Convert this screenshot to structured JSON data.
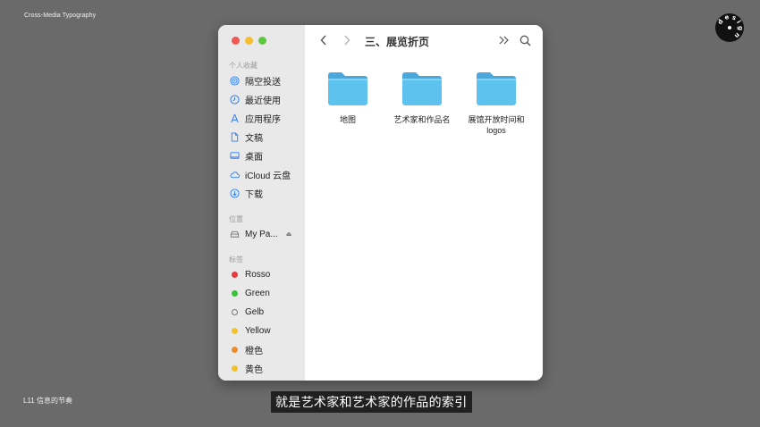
{
  "overlay": {
    "course_title": "Cross-Media Typography",
    "logo_text": "design",
    "lesson_label": "L11  信息的节奏",
    "subtitle": "就是艺术家和艺术家的作品的索引"
  },
  "window": {
    "title": "三、展览折页",
    "traffic_lights": {
      "close": "#ee5a52",
      "minimize": "#f5bd2f",
      "zoom": "#5fc63f"
    }
  },
  "sidebar": {
    "favorites_header": "个人收藏",
    "favorites": [
      {
        "label": "隔空投送",
        "icon": "airdrop-icon"
      },
      {
        "label": "最近使用",
        "icon": "clock-icon"
      },
      {
        "label": "应用程序",
        "icon": "applications-icon"
      },
      {
        "label": "文稿",
        "icon": "document-icon"
      },
      {
        "label": "桌面",
        "icon": "desktop-icon"
      },
      {
        "label": "iCloud 云盘",
        "icon": "cloud-icon"
      },
      {
        "label": "下载",
        "icon": "download-icon"
      }
    ],
    "locations_header": "位置",
    "locations": [
      {
        "label": "My Pa...",
        "icon": "drive-icon"
      }
    ],
    "tags_header": "标签",
    "tags": [
      {
        "label": "Rosso",
        "color": "#e8393c"
      },
      {
        "label": "Green",
        "color": "#37c337"
      },
      {
        "label": "Gelb",
        "color": "hollow"
      },
      {
        "label": "Yellow",
        "color": "#f1c12f"
      },
      {
        "label": "橙色",
        "color": "#f08c2a"
      },
      {
        "label": "黄色",
        "color": "#f1c12f"
      }
    ]
  },
  "folders": [
    {
      "label": "地图"
    },
    {
      "label": "艺术家和作品名"
    },
    {
      "label": "展馆开放时间和logos"
    }
  ],
  "colors": {
    "folder": "#5ec2ee",
    "folder_tab": "#4aa8dc",
    "accent": "#2e7cf6"
  }
}
